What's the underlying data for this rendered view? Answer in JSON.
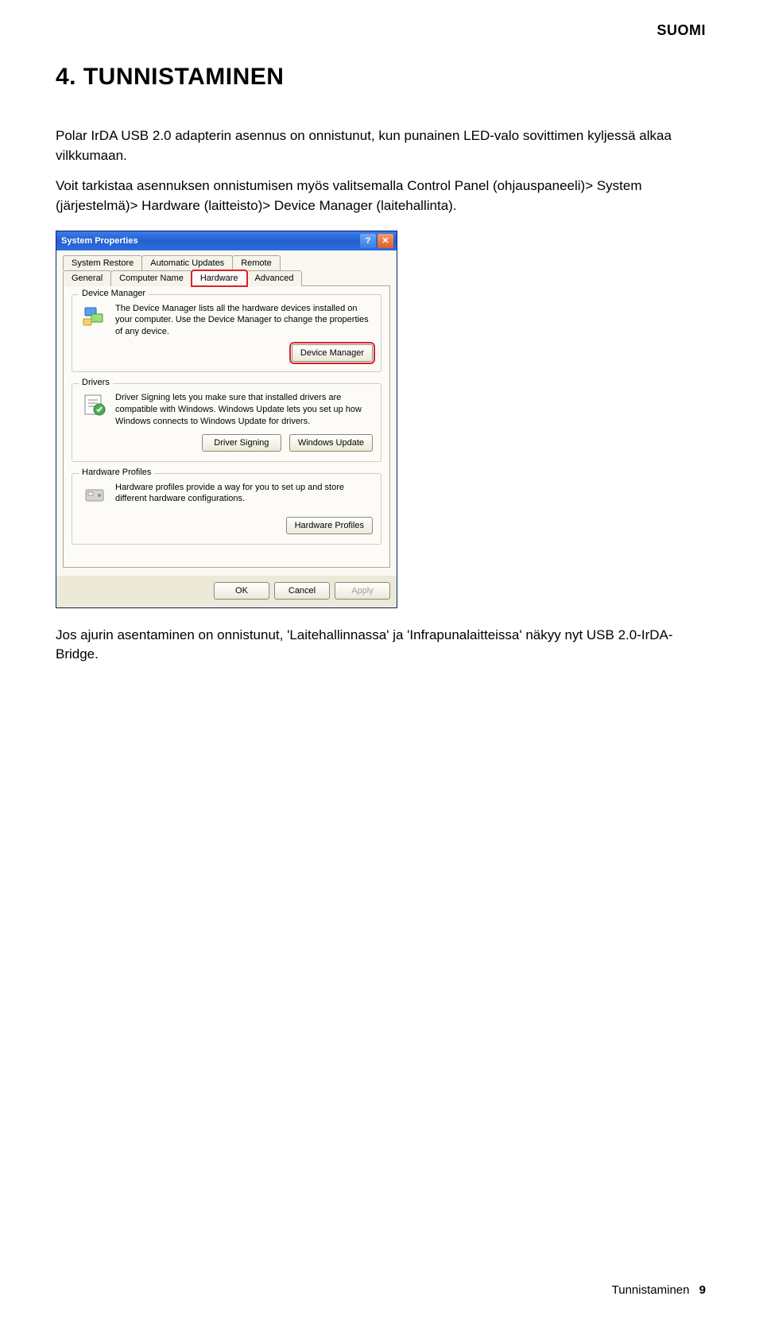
{
  "lang_tag": "SUOMI",
  "heading": "4. TUNNISTAMINEN",
  "para1": "Polar IrDA USB 2.0 adapterin asennus on onnistunut, kun punainen LED-valo sovittimen kyljessä alkaa vilkkumaan.",
  "para2": "Voit tarkistaa asennuksen onnistumisen myös valitsemalla Control Panel (ohjauspaneeli)> System (järjestelmä)> Hardware (laitteisto)> Device Manager (laitehallinta).",
  "para3": "Jos ajurin asentaminen on onnistunut, 'Laitehallinnassa' ja 'Infrapunalaitteissa' näkyy nyt USB 2.0-IrDA-Bridge.",
  "dialog": {
    "title": "System Properties",
    "tabs_row1": [
      "System Restore",
      "Automatic Updates",
      "Remote"
    ],
    "tabs_row2": [
      "General",
      "Computer Name",
      "Hardware",
      "Advanced"
    ],
    "active_tab": "Hardware",
    "device_manager": {
      "legend": "Device Manager",
      "text": "The Device Manager lists all the hardware devices installed on your computer. Use the Device Manager to change the properties of any device.",
      "button": "Device Manager"
    },
    "drivers": {
      "legend": "Drivers",
      "text": "Driver Signing lets you make sure that installed drivers are compatible with Windows. Windows Update lets you set up how Windows connects to Windows Update for drivers.",
      "button1": "Driver Signing",
      "button2": "Windows Update"
    },
    "hardware_profiles": {
      "legend": "Hardware Profiles",
      "text": "Hardware profiles provide a way for you to set up and store different hardware configurations.",
      "button": "Hardware Profiles"
    },
    "footer": {
      "ok": "OK",
      "cancel": "Cancel",
      "apply": "Apply"
    }
  },
  "footer": {
    "section": "Tunnistaminen",
    "page_num": "9"
  }
}
